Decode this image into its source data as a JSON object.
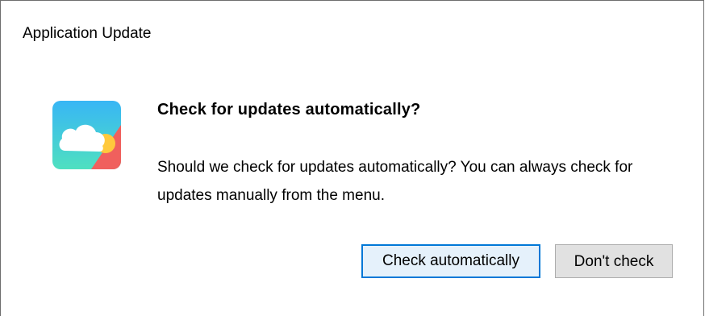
{
  "window": {
    "title": "Application Update"
  },
  "dialog": {
    "icon": "cloud-sun-app-icon",
    "heading": "Check for updates automatically?",
    "message": "Should we check for updates automatically? You can always check for updates manually from the menu."
  },
  "buttons": {
    "primary_label": "Check automatically",
    "secondary_label": "Don't check"
  },
  "colors": {
    "primary_button_border": "#0078d7",
    "button_background": "#e1e1e1",
    "icon_gradient_top": "#38b6f5",
    "icon_gradient_bottom": "#4fe0c0",
    "sun_color": "#ffc93c",
    "sunset_color": "#f0605d"
  }
}
